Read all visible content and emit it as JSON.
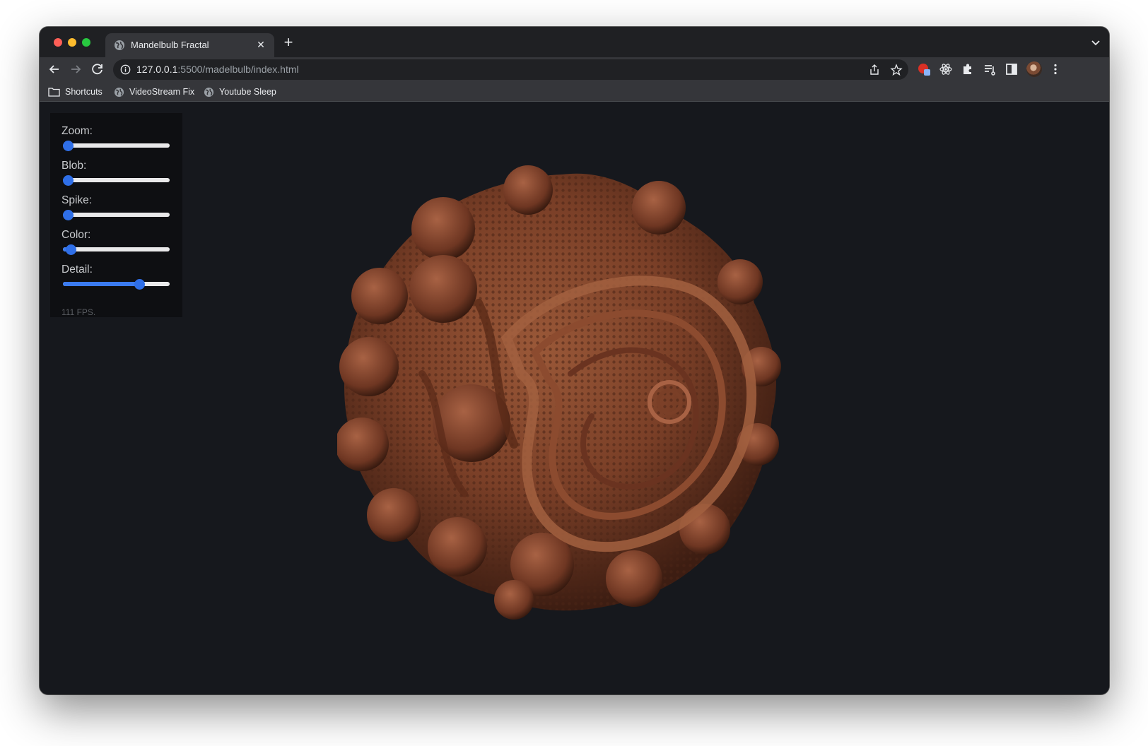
{
  "browser": {
    "tab_title": "Mandelbulb Fractal",
    "url_host": "127.0.0.1",
    "url_rest": ":5500/madelbulb/index.html",
    "bookmarks": [
      {
        "label": "Shortcuts",
        "icon": "folder-icon"
      },
      {
        "label": "VideoStream Fix",
        "icon": "globe-icon"
      },
      {
        "label": "Youtube Sleep",
        "icon": "globe-icon"
      }
    ]
  },
  "controls": {
    "zoom": {
      "label": "Zoom:",
      "value": 0.0
    },
    "blob": {
      "label": "Blob:",
      "value": 0.0
    },
    "spike": {
      "label": "Spike:",
      "value": 0.0
    },
    "color": {
      "label": "Color:",
      "value": 0.03
    },
    "detail": {
      "label": "Detail:",
      "value": 0.74
    },
    "fps": "111 FPS."
  },
  "colors": {
    "accent": "#2f6fe8",
    "page_bg": "#16181d",
    "fractal": "#8a4a30"
  }
}
